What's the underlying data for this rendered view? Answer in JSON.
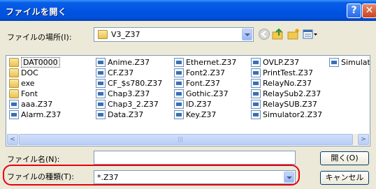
{
  "dialog": {
    "title": "ファイルを開く",
    "help_glyph": "?",
    "close_glyph": "✕"
  },
  "location": {
    "label": "ファイルの場所(I):",
    "value": "V3_Z37"
  },
  "toolbar": {
    "icons": [
      "back-icon",
      "up-folder-icon",
      "new-folder-icon",
      "view-menu-icon"
    ]
  },
  "file_list": {
    "columns": [
      [
        {
          "name": "DAT0000",
          "type": "folder",
          "selected": true
        },
        {
          "name": "DOC",
          "type": "folder"
        },
        {
          "name": "exe",
          "type": "folder"
        },
        {
          "name": "Font",
          "type": "folder"
        },
        {
          "name": "aaa.Z37",
          "type": "file"
        },
        {
          "name": "Alarm.Z37",
          "type": "file"
        }
      ],
      [
        {
          "name": "Anime.Z37",
          "type": "file"
        },
        {
          "name": "CF.Z37",
          "type": "file"
        },
        {
          "name": "CF_$s780.Z37",
          "type": "file"
        },
        {
          "name": "Chap3.Z37",
          "type": "file"
        },
        {
          "name": "Chap3_2.Z37",
          "type": "file"
        },
        {
          "name": "Data.Z37",
          "type": "file"
        }
      ],
      [
        {
          "name": "Ethernet.Z37",
          "type": "file"
        },
        {
          "name": "Font2.Z37",
          "type": "file"
        },
        {
          "name": "Font.Z37",
          "type": "file"
        },
        {
          "name": "Gothic.Z37",
          "type": "file"
        },
        {
          "name": "ID.Z37",
          "type": "file"
        },
        {
          "name": "Key.Z37",
          "type": "file"
        }
      ],
      [
        {
          "name": "OVLP.Z37",
          "type": "file"
        },
        {
          "name": "PrintTest.Z37",
          "type": "file"
        },
        {
          "name": "RelayNo.Z37",
          "type": "file"
        },
        {
          "name": "RelaySub2.Z37",
          "type": "file"
        },
        {
          "name": "RelaySUB.Z37",
          "type": "file"
        },
        {
          "name": "Simulator2.Z37",
          "type": "file"
        }
      ],
      [
        {
          "name": "Simulat",
          "type": "file"
        }
      ]
    ]
  },
  "scrollbar": {
    "left_arrow": "<",
    "right_arrow": ">",
    "grip": "|||"
  },
  "filename": {
    "label": "ファイル名(N):",
    "value": ""
  },
  "filetype": {
    "label": "ファイルの種類(T):",
    "value": "*.Z37"
  },
  "buttons": {
    "open": "開く(O)",
    "cancel": "キャンセル"
  },
  "colors": {
    "title_bar": "#0054e3",
    "dialog_bg": "#ece9d8",
    "highlight_ring": "#e8000d"
  }
}
